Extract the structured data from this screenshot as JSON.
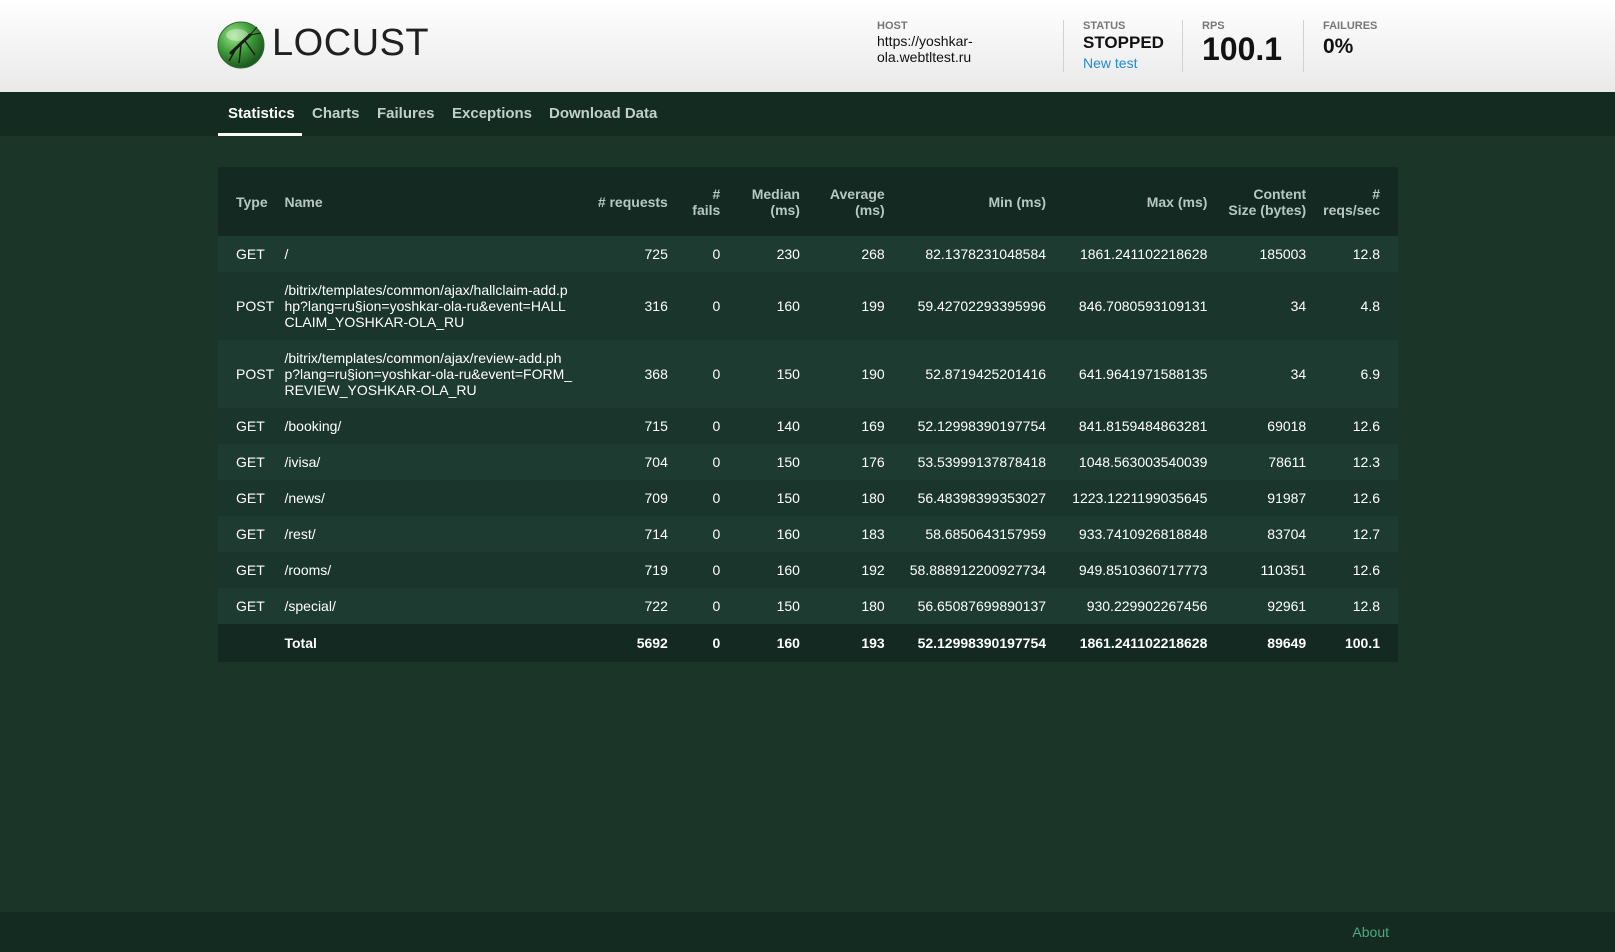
{
  "header": {
    "logo_text": "LOCUST",
    "host_label": "HOST",
    "host_value": "https://yoshkar-ola.webtltest.ru",
    "status_label": "STATUS",
    "status_value": "STOPPED",
    "new_test_link": "New test",
    "rps_label": "RPS",
    "rps_value": "100.1",
    "failures_label": "FAILURES",
    "failures_value": "0%"
  },
  "tabs": [
    "Statistics",
    "Charts",
    "Failures",
    "Exceptions",
    "Download Data"
  ],
  "active_tab": "Statistics",
  "table": {
    "columns": [
      "Type",
      "Name",
      "# requests",
      "# fails",
      "Median (ms)",
      "Average (ms)",
      "Min (ms)",
      "Max (ms)",
      "Content Size (bytes)",
      "# reqs/sec"
    ],
    "rows": [
      [
        "GET",
        "/",
        "725",
        "0",
        "230",
        "268",
        "82.1378231048584",
        "1861.241102218628",
        "185003",
        "12.8"
      ],
      [
        "POST",
        "/bitrix/templates/common/ajax/hallclaim-add.php?lang=ru§ion=yoshkar-ola-ru&event=HALLCLAIM_YOSHKAR-OLA_RU",
        "316",
        "0",
        "160",
        "199",
        "59.42702293395996",
        "846.7080593109131",
        "34",
        "4.8"
      ],
      [
        "POST",
        "/bitrix/templates/common/ajax/review-add.php?lang=ru§ion=yoshkar-ola-ru&event=FORM_REVIEW_YOSHKAR-OLA_RU",
        "368",
        "0",
        "150",
        "190",
        "52.8719425201416",
        "641.9641971588135",
        "34",
        "6.9"
      ],
      [
        "GET",
        "/booking/",
        "715",
        "0",
        "140",
        "169",
        "52.12998390197754",
        "841.8159484863281",
        "69018",
        "12.6"
      ],
      [
        "GET",
        "/ivisa/",
        "704",
        "0",
        "150",
        "176",
        "53.53999137878418",
        "1048.563003540039",
        "78611",
        "12.3"
      ],
      [
        "GET",
        "/news/",
        "709",
        "0",
        "150",
        "180",
        "56.48398399353027",
        "1223.1221199035645",
        "91987",
        "12.6"
      ],
      [
        "GET",
        "/rest/",
        "714",
        "0",
        "160",
        "183",
        "58.6850643157959",
        "933.7410926818848",
        "83704",
        "12.7"
      ],
      [
        "GET",
        "/rooms/",
        "719",
        "0",
        "160",
        "192",
        "58.888912200927734",
        "949.8510360717773",
        "110351",
        "12.6"
      ],
      [
        "GET",
        "/special/",
        "722",
        "0",
        "150",
        "180",
        "56.65087699890137",
        "930.229902267456",
        "92961",
        "12.8"
      ]
    ],
    "total": [
      "",
      "Total",
      "5692",
      "0",
      "160",
      "193",
      "52.12998390197754",
      "1861.241102218628",
      "89649",
      "100.1"
    ]
  },
  "footer": {
    "about_link": "About"
  }
}
